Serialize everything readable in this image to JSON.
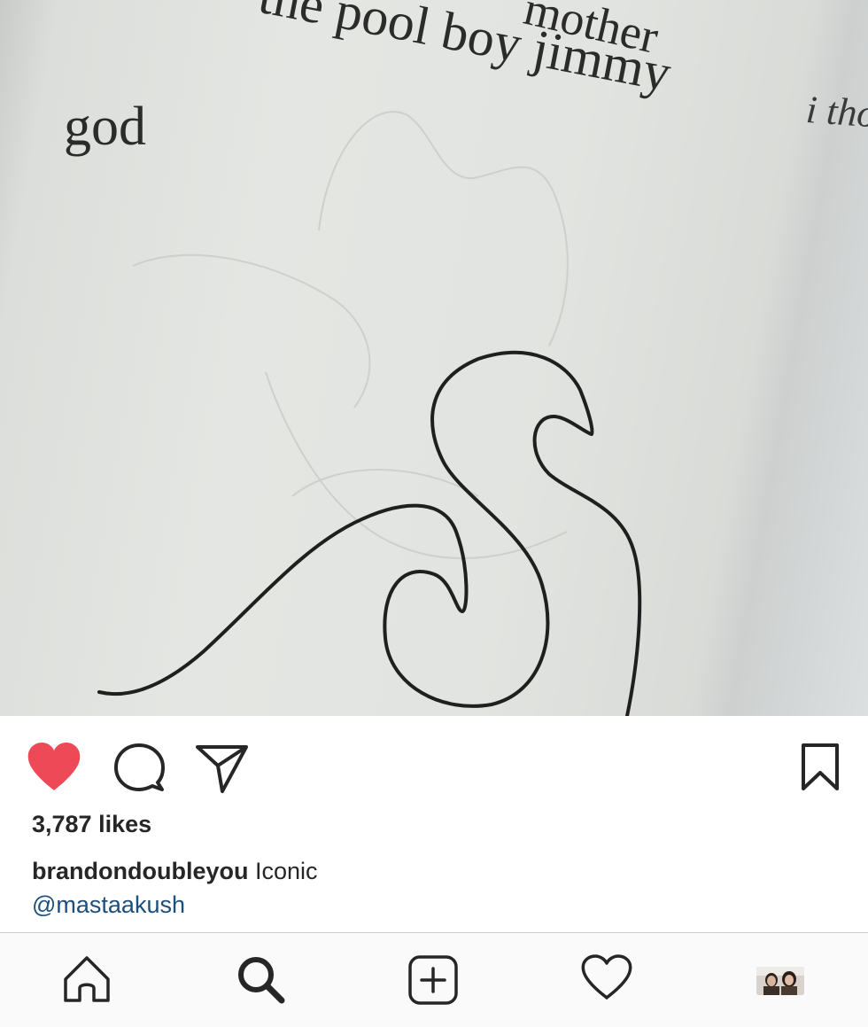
{
  "post": {
    "image": {
      "page_text_top_right": "mother",
      "page_text_top": "the pool boy jimmy",
      "page_text_left": "god",
      "page_text_right_page": "i tho"
    },
    "likes": "3,787 likes",
    "caption": {
      "username": "brandondoubleyou",
      "text": "Iconic",
      "mention": "@mastaakush"
    },
    "liked": true
  },
  "icons": {
    "like": "heart-filled-icon",
    "comment": "comment-bubble-icon",
    "share": "paper-plane-icon",
    "save": "bookmark-icon"
  },
  "tabbar": {
    "items": [
      "home-icon",
      "search-icon",
      "add-post-icon",
      "activity-heart-icon",
      "profile-avatar"
    ]
  },
  "colors": {
    "like_red": "#ed4956",
    "text": "#262626",
    "mention_link": "#1d4f7c",
    "tabbar_bg": "#fafafa"
  }
}
